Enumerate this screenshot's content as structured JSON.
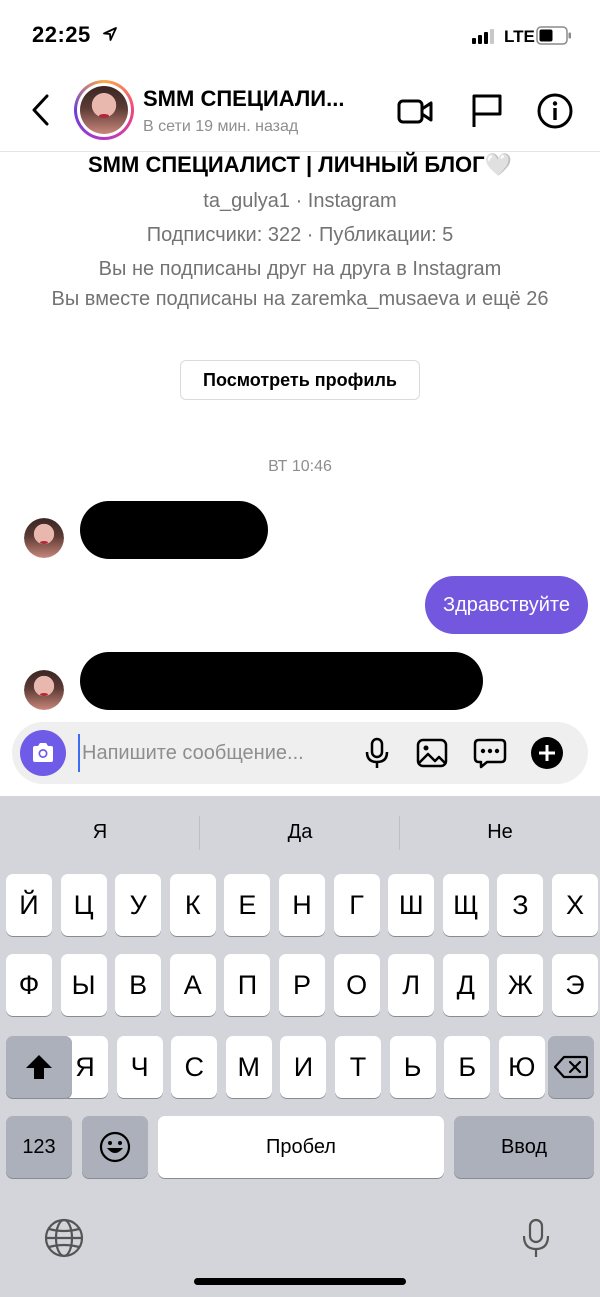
{
  "status_bar": {
    "time": "22:25",
    "network": "LTE"
  },
  "header": {
    "title": "SMM СПЕЦИАЛИ...",
    "subtitle": "В сети 19 мин. назад"
  },
  "profile": {
    "name": "SMM СПЕЦИАЛИСТ | ЛИЧНЫЙ БЛОГ🤍",
    "handle": "ta_gulya1 · Instagram",
    "stats": "Подписчики: 322 · Публикации: 5",
    "follow_status": "Вы не подписаны друг на друга в Instagram",
    "mutual": "Вы вместе подписаны на zaremka_musaeva и ещё 26",
    "view_profile_label": "Посмотреть профиль"
  },
  "chat": {
    "timestamp": "ВТ 10:46",
    "messages": [
      {
        "direction": "incoming",
        "text": "",
        "redacted": true
      },
      {
        "direction": "outgoing",
        "text": "Здравствуйте"
      },
      {
        "direction": "incoming",
        "text": "",
        "redacted": true
      }
    ],
    "outgoing_color": "#7357de"
  },
  "composer": {
    "placeholder": "Напишите сообщение...",
    "camera_color": "#6e5ce8",
    "icons": [
      "camera-icon",
      "microphone-icon",
      "gallery-icon",
      "sticker-icon",
      "plus-icon"
    ]
  },
  "keyboard": {
    "suggestions": [
      "Я",
      "Да",
      "Не"
    ],
    "row1": [
      "Й",
      "Ц",
      "У",
      "К",
      "Е",
      "Н",
      "Г",
      "Ш",
      "Щ",
      "З",
      "Х"
    ],
    "row2": [
      "Ф",
      "Ы",
      "В",
      "А",
      "П",
      "Р",
      "О",
      "Л",
      "Д",
      "Ж",
      "Э"
    ],
    "row3": [
      "Я",
      "Ч",
      "С",
      "М",
      "И",
      "Т",
      "Ь",
      "Б",
      "Ю"
    ],
    "numbers_label": "123",
    "space_label": "Пробел",
    "return_label": "Ввод"
  }
}
